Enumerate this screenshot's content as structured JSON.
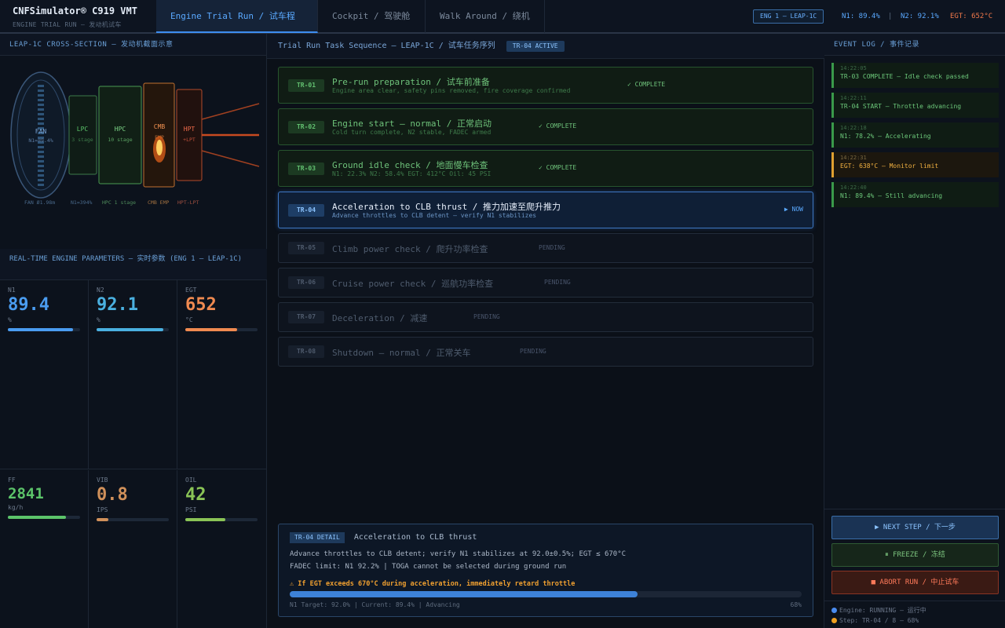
{
  "header": {
    "app_title": "CNFSimulator® C919 VMT",
    "app_subtitle": "ENGINE TRIAL RUN — 发动机试车",
    "tabs": [
      {
        "label": "Engine Trial Run / 试车程序"
      },
      {
        "label": "Cockpit / 驾驶舱"
      },
      {
        "label": "Walk Around / 绕机"
      }
    ],
    "engine_badge": "ENG 1 — LEAP-1C",
    "n1": "N1: 89.4%",
    "sep": "|",
    "n2": "N2: 92.1%",
    "egt": "EGT: 652°C"
  },
  "left": {
    "section_title": "LEAP-1C CROSS-SECTION — 发动机截面示意",
    "diagram": {
      "fan": "FAN",
      "fan_n1": "N1=89.4%",
      "lpc": "LPC",
      "lpc_sub": "3 stage",
      "hpc": "HPC",
      "hpc_sub": "10 stage",
      "cmb": "CMB",
      "cmb_sub": "EMP",
      "hpt": "HPT",
      "hpt_sub": "+LPT",
      "footer": [
        "FAN Ø1.98m",
        "N1=394%",
        "HPC 1 stage",
        "CMB EMP",
        "HPT-LPT"
      ]
    },
    "params_title": "REAL-TIME ENGINE PARAMETERS — 实时参数 (ENG 1 — LEAP-1C)",
    "params": [
      {
        "key": "N1",
        "value": "89.4",
        "unit": "%",
        "fill": 0.9,
        "color": "#4a9cf0"
      },
      {
        "key": "N2",
        "value": "92.1",
        "unit": "%",
        "fill": 0.92,
        "color": "#4ab0e0"
      },
      {
        "key": "EGT",
        "value": "652",
        "unit": "°C",
        "fill": 0.72,
        "color": "#f08a50"
      },
      {
        "key": "FF",
        "value": "2841",
        "unit": "kg/h",
        "fill": 0.8,
        "color": "#5cc46a"
      },
      {
        "key": "VIB",
        "value": "0.8",
        "unit": "IPS",
        "fill": 0.16,
        "color": "#d0905a"
      },
      {
        "key": "OIL",
        "value": "42",
        "unit": "PSI",
        "fill": 0.55,
        "color": "#8ac456"
      }
    ]
  },
  "center": {
    "title": "Trial Run Task Sequence — LEAP-1C / 试车任务序列",
    "active_badge": "TR-04 ACTIVE",
    "tasks": [
      {
        "id": "TR-01",
        "name": "Pre-run preparation / 试车前准备",
        "sub": "Engine area clear, safety pins removed, fire coverage confirmed",
        "status": "✓ COMPLETE",
        "state": "done"
      },
      {
        "id": "TR-02",
        "name": "Engine start — normal / 正常启动",
        "sub": "Cold turn complete, N2 stable, FADEC armed",
        "status": "✓ COMPLETE",
        "state": "done"
      },
      {
        "id": "TR-03",
        "name": "Ground idle check / 地面慢车检查",
        "sub": "N1: 22.3% N2: 58.4% EGT: 412°C Oil: 45 PSI",
        "status": "✓ COMPLETE",
        "state": "done"
      },
      {
        "id": "TR-04",
        "name": "Acceleration to CLB thrust / 推力加速至爬升推力",
        "sub": "Advance throttles to CLB detent — verify N1 stabilizes",
        "status": "▶ NOW",
        "state": "now"
      },
      {
        "id": "TR-05",
        "name": "Climb power check / 爬升功率检查",
        "sub": "",
        "status": "PENDING",
        "state": "pend"
      },
      {
        "id": "TR-06",
        "name": "Cruise power check / 巡航功率检查",
        "sub": "",
        "status": "PENDING",
        "state": "pend"
      },
      {
        "id": "TR-07",
        "name": "Deceleration / 减速",
        "sub": "",
        "status": "PENDING",
        "state": "pend"
      },
      {
        "id": "TR-08",
        "name": "Shutdown — normal / 正常关车",
        "sub": "",
        "status": "PENDING",
        "state": "pend"
      }
    ],
    "detail": {
      "tag": "TR-04 DETAIL",
      "title": "Acceleration to CLB thrust",
      "line1": "Advance throttles to CLB detent; verify N1 stabilizes at 92.0±0.5%; EGT ≤ 670°C",
      "line2": "FADEC limit: N1 92.2% | TOGA cannot be selected during ground run",
      "warning": "⚠ If EGT exceeds 670°C during acceleration, immediately retard throttle",
      "progress": 0.68,
      "caption": "N1 Target: 92.0% | Current: 89.4% | Advancing",
      "percent": "68%"
    }
  },
  "right": {
    "title": "EVENT LOG / 事件记录",
    "events": [
      {
        "time": "14:22:05",
        "text": "TR-03 COMPLETE — Idle check passed",
        "level": "ok"
      },
      {
        "time": "14:22:11",
        "text": "TR-04 START — Throttle advancing",
        "level": "ok"
      },
      {
        "time": "14:22:18",
        "text": "N1: 78.2% — Accelerating",
        "level": "ok"
      },
      {
        "time": "14:22:31",
        "text": "EGT: 638°C — Monitor limit",
        "level": "warn"
      },
      {
        "time": "14:22:40",
        "text": "N1: 89.4% — Still advancing",
        "level": "ok"
      }
    ],
    "buttons": {
      "next": "▶ NEXT STEP / 下一步",
      "freeze": "⏸ FREEZE / 冻结",
      "abort": "■ ABORT RUN / 中止试车"
    },
    "footer": {
      "engine": "Engine: RUNNING — 运行中",
      "step": "Step: TR-04 / 8 — 68%",
      "engine_color": "#4a8cf0",
      "step_color": "#f0a020"
    }
  }
}
